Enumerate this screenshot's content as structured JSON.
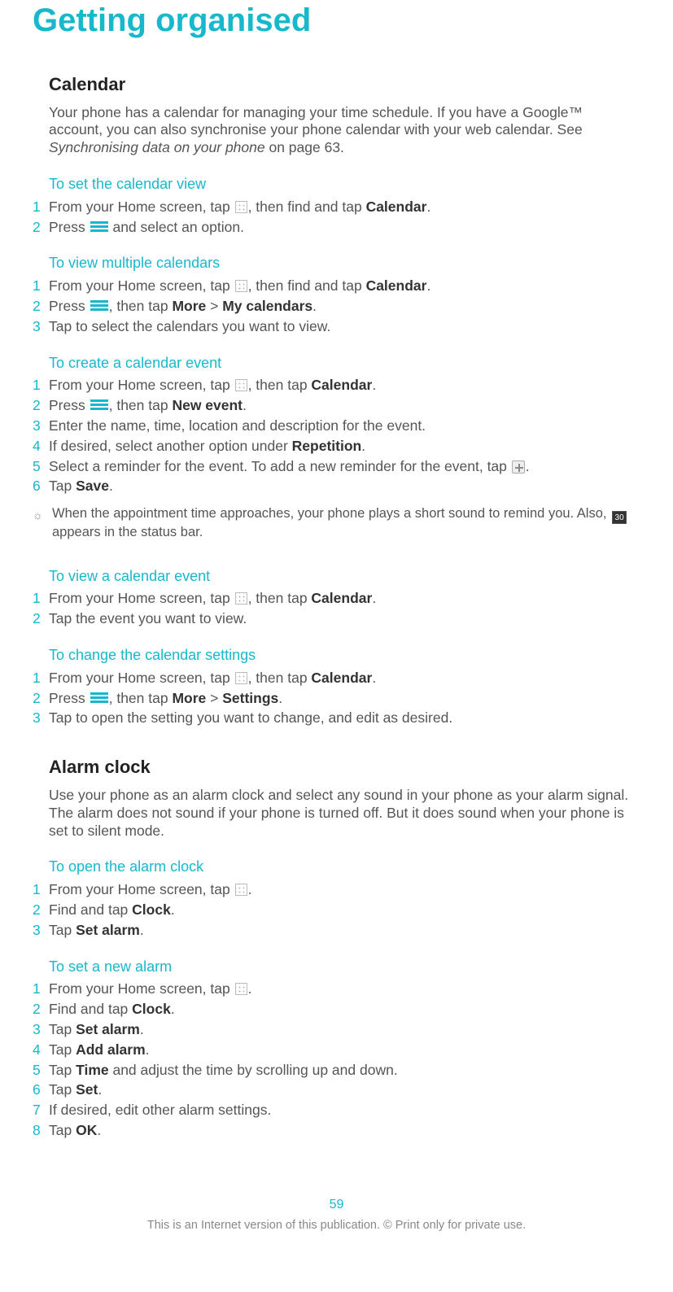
{
  "pageTitle": "Getting organised",
  "calendar": {
    "heading": "Calendar",
    "intro1": "Your phone has a calendar for managing your time schedule. If you have a Google™ account, you can also synchronise your phone calendar with your web calendar. See ",
    "introItalic": "Synchronising data on your phone",
    "intro2": " on page 63.",
    "setView": {
      "title": "To set the calendar view",
      "steps": {
        "s1a": "From your Home screen, tap ",
        "s1b": ", then find and tap ",
        "s1bold": "Calendar",
        "s1c": ".",
        "s2a": "Press ",
        "s2b": " and select an option."
      }
    },
    "multi": {
      "title": "To view multiple calendars",
      "steps": {
        "s1a": "From your Home screen, tap ",
        "s1b": ", then find and tap ",
        "s1bold": "Calendar",
        "s1c": ".",
        "s2a": "Press ",
        "s2b": ", then tap ",
        "s2bold1": "More",
        "s2mid": " > ",
        "s2bold2": "My calendars",
        "s2end": ".",
        "s3": "Tap to select the calendars you want to view."
      }
    },
    "create": {
      "title": "To create a calendar event",
      "steps": {
        "s1a": "From your Home screen, tap ",
        "s1b": ", then tap ",
        "s1bold": "Calendar",
        "s1c": ".",
        "s2a": "Press ",
        "s2b": ", then tap ",
        "s2bold": "New event",
        "s2end": ".",
        "s3": "Enter the name, time, location and description for the event.",
        "s4a": "If desired, select another option under ",
        "s4bold": "Repetition",
        "s4end": ".",
        "s5a": "Select a reminder for the event. To add a new reminder for the event, tap ",
        "s5end": ".",
        "s6a": "Tap ",
        "s6bold": "Save",
        "s6end": "."
      },
      "hintA": "When the appointment time approaches, your phone plays a short sound to remind you. Also, ",
      "hintCal": "30",
      "hintB": " appears in the status bar."
    },
    "viewEvent": {
      "title": "To view a calendar event",
      "steps": {
        "s1a": "From your Home screen, tap ",
        "s1b": ", then tap ",
        "s1bold": "Calendar",
        "s1c": ".",
        "s2": "Tap the event you want to view."
      }
    },
    "settings": {
      "title": "To change the calendar settings",
      "steps": {
        "s1a": "From your Home screen, tap ",
        "s1b": ", then tap ",
        "s1bold": "Calendar",
        "s1c": ".",
        "s2a": "Press ",
        "s2b": ", then tap ",
        "s2bold1": "More",
        "s2mid": " > ",
        "s2bold2": "Settings",
        "s2end": ".",
        "s3": "Tap to open the setting you want to change, and edit as desired."
      }
    }
  },
  "alarm": {
    "heading": "Alarm clock",
    "intro": "Use your phone as an alarm clock and select any sound in your phone as your alarm signal. The alarm does not sound if your phone is turned off. But it does sound when your phone is set to silent mode.",
    "open": {
      "title": "To open the alarm clock",
      "steps": {
        "s1a": "From your Home screen, tap ",
        "s1end": ".",
        "s2a": "Find and tap ",
        "s2bold": "Clock",
        "s2end": ".",
        "s3a": "Tap ",
        "s3bold": "Set alarm",
        "s3end": "."
      }
    },
    "new": {
      "title": "To set a new alarm",
      "steps": {
        "s1a": "From your Home screen, tap ",
        "s1end": ".",
        "s2a": "Find and tap ",
        "s2bold": "Clock",
        "s2end": ".",
        "s3a": "Tap ",
        "s3bold": "Set alarm",
        "s3end": ".",
        "s4a": "Tap ",
        "s4bold": "Add alarm",
        "s4end": ".",
        "s5a": "Tap ",
        "s5bold": "Time",
        "s5end": " and adjust the time by scrolling up and down.",
        "s6a": "Tap ",
        "s6bold": "Set",
        "s6end": ".",
        "s7": "If desired, edit other alarm settings.",
        "s8a": "Tap ",
        "s8bold": "OK",
        "s8end": "."
      }
    }
  },
  "pageNumber": "59",
  "footer": "This is an Internet version of this publication. © Print only for private use."
}
